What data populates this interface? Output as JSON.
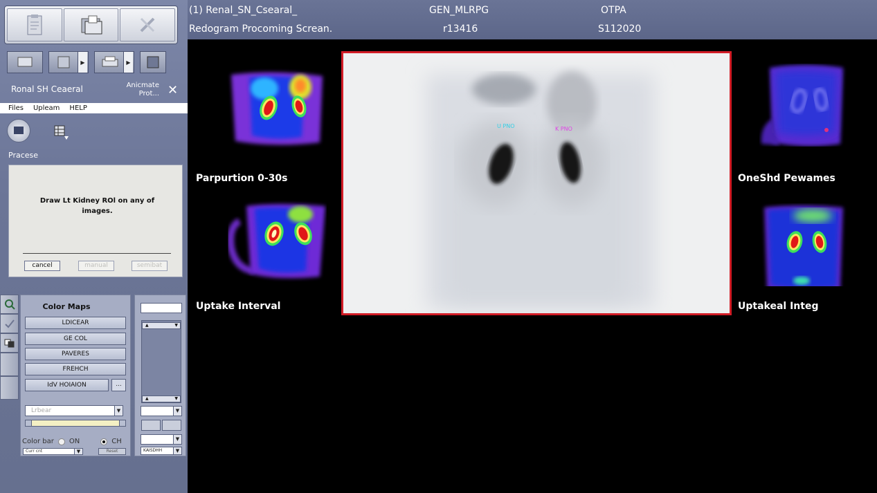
{
  "header": {
    "study": "(1) Renal_SN_Csearal_",
    "protocol": "GEN_MLRPG",
    "method": "OTPA",
    "screen": "Redogram Procoming Screan.",
    "id": "r13416",
    "series": "S112020"
  },
  "window": {
    "name": "Ronal  SH Ceaeral",
    "subtitle_1": "Anicmate",
    "subtitle_2": "Prot...",
    "close": "✕"
  },
  "menu": [
    "Files",
    "Upleam",
    "HELP"
  ],
  "process": {
    "label": "Pracese"
  },
  "instruction": {
    "message": "Draw Lt Kidney ROl on any of images.",
    "cancel": "cancel",
    "manual": "manual",
    "semibat": "semibat"
  },
  "color_maps": {
    "title": "Color Maps",
    "items": [
      "LDICEAR",
      "GE COL",
      "PAVERES",
      "FREHCH",
      "IdV HOIAION"
    ],
    "ellipsis": "...",
    "lut_select": "Lrbear",
    "color_bar_label": "Color bar",
    "on_label": "ON",
    "ch_label": "CH",
    "curr_cnt": "Curr cnt",
    "reset": "Reset"
  },
  "right_column": {
    "bottom_select": "KAISDHH"
  },
  "images": {
    "top_left": "Parpurtion 0-30s",
    "bottom_left": "Uptake Interval",
    "top_right": "OneShd Pewames",
    "bottom_right": "Uptakeal Integ",
    "roi_left": "U PNO",
    "roi_right": "K PNO"
  },
  "colors": {
    "roi_border": "#d21c26",
    "panel": "#6b7597",
    "header": "#5c6689"
  }
}
